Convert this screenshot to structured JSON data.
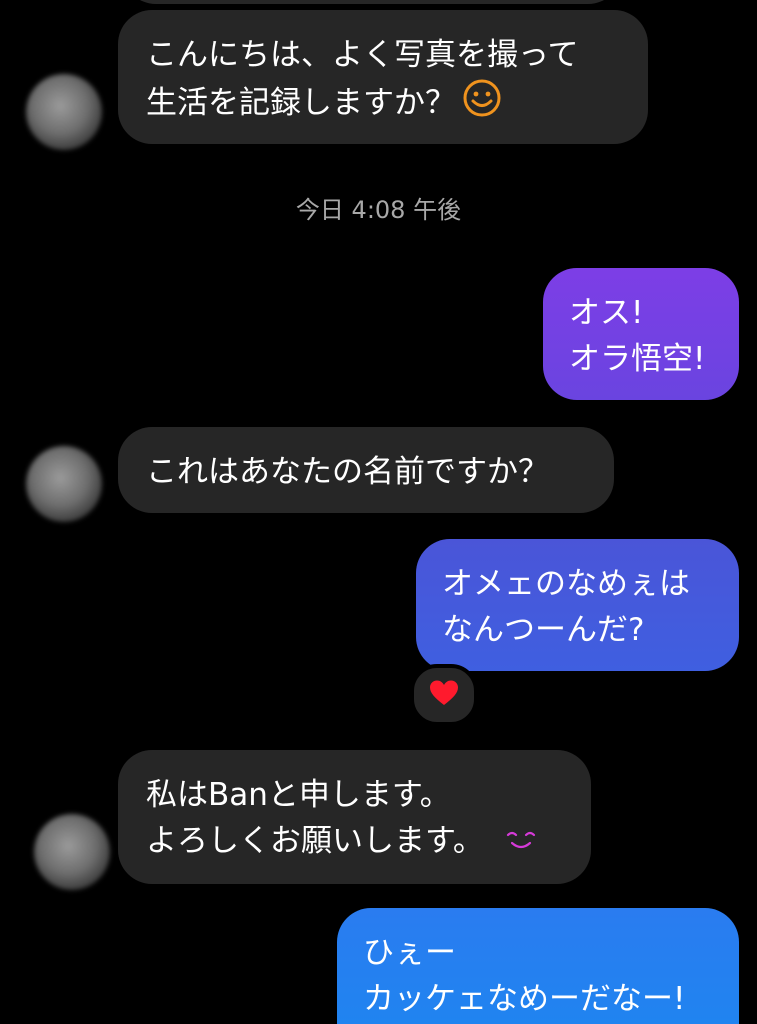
{
  "conversation": {
    "timestamp": "今日 4:08 午後",
    "messages": [
      {
        "direction": "incoming",
        "lines": [
          "こんにちは、よく写真を撮って",
          "生活を記録しますか？"
        ],
        "emoji": "smiling-face-outline-orange"
      },
      {
        "direction": "outgoing",
        "lines": [
          "オス!",
          "オラ悟空!"
        ]
      },
      {
        "direction": "incoming",
        "lines": [
          "これはあなたの名前ですか？"
        ]
      },
      {
        "direction": "outgoing",
        "lines": [
          "オメェのなめぇは",
          "なんつーんだ?"
        ],
        "reaction": "heart-icon"
      },
      {
        "direction": "incoming",
        "lines": [
          "私はBanと申します。",
          "よろしくお願いします。"
        ],
        "emoji": "smiling-eyes-magenta"
      },
      {
        "direction": "outgoing",
        "lines": [
          "ひぇー",
          "カッケェなめーだなー!"
        ]
      }
    ]
  },
  "colors": {
    "background": "#000000",
    "incoming_bubble": "#262626",
    "outgoing_gradient_top": "#7b3fe4",
    "outgoing_gradient_mid": "#4b55d6",
    "outgoing_gradient_bottom": "#1d86f0",
    "timestamp_text": "#a8a8a8",
    "heart": "#ff1a2d"
  }
}
